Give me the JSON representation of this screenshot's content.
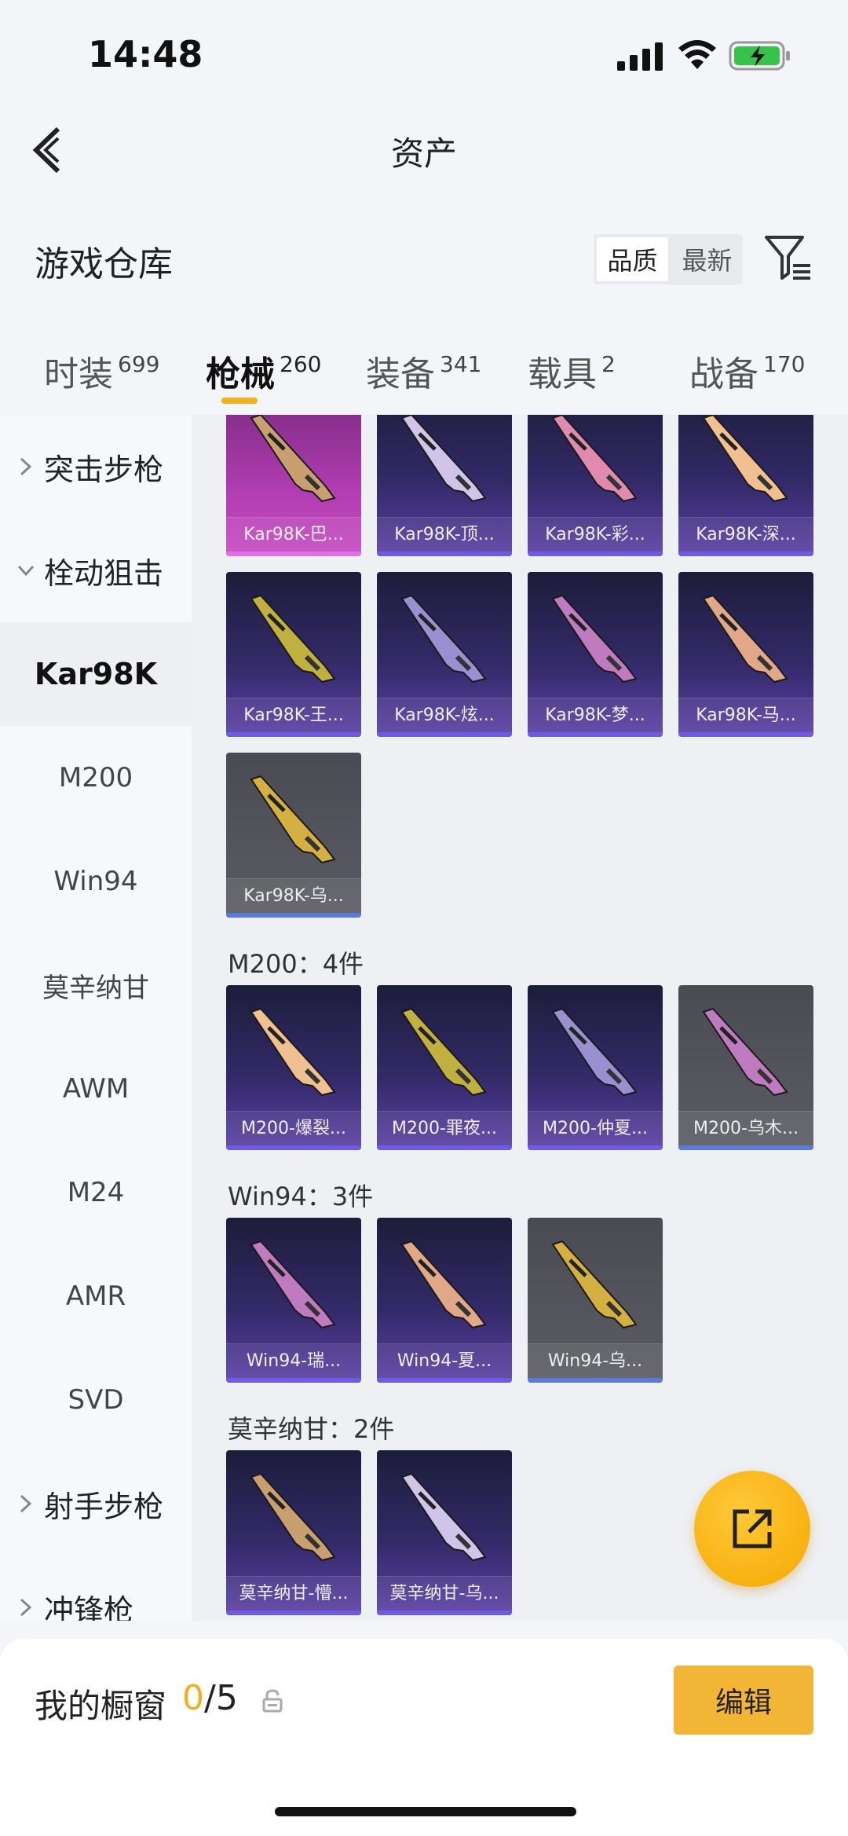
{
  "status_bar": {
    "time": "14:48",
    "icons": [
      "signal-icon",
      "wifi-icon",
      "battery-charging-icon"
    ]
  },
  "nav": {
    "title": "资产",
    "back_icon": "chevron-left-icon"
  },
  "warehouse": {
    "title": "游戏仓库",
    "sort_options": [
      "品质",
      "最新"
    ],
    "sort_selected": "品质",
    "filter_icon": "filter-icon"
  },
  "tabs": [
    {
      "label": "时装",
      "count": "699"
    },
    {
      "label": "枪械",
      "count": "260",
      "active": true
    },
    {
      "label": "装备",
      "count": "341"
    },
    {
      "label": "载具",
      "count": "2"
    },
    {
      "label": "战备",
      "count": "170"
    }
  ],
  "side_nav": [
    {
      "label": "突击步枪",
      "type": "group",
      "expanded": false
    },
    {
      "label": "栓动狙击",
      "type": "group",
      "expanded": true
    },
    {
      "label": "Kar98K",
      "type": "item",
      "selected": true
    },
    {
      "label": "M200",
      "type": "item"
    },
    {
      "label": "Win94",
      "type": "item"
    },
    {
      "label": "莫辛纳甘",
      "type": "item"
    },
    {
      "label": "AWM",
      "type": "item"
    },
    {
      "label": "M24",
      "type": "item"
    },
    {
      "label": "AMR",
      "type": "item"
    },
    {
      "label": "SVD",
      "type": "item"
    },
    {
      "label": "射手步枪",
      "type": "group",
      "expanded": false
    },
    {
      "label": "冲锋枪",
      "type": "group",
      "expanded": false
    }
  ],
  "groups": [
    {
      "heading": "",
      "items": [
        {
          "label": "Kar98K-巴...",
          "rarity": "pink"
        },
        {
          "label": "Kar98K-顶...",
          "rarity": "purple"
        },
        {
          "label": "Kar98K-彩...",
          "rarity": "purple"
        },
        {
          "label": "Kar98K-深...",
          "rarity": "purple"
        },
        {
          "label": "Kar98K-王...",
          "rarity": "purple"
        },
        {
          "label": "Kar98K-炫...",
          "rarity": "purple"
        },
        {
          "label": "Kar98K-梦...",
          "rarity": "purple"
        },
        {
          "label": "Kar98K-马...",
          "rarity": "purple"
        },
        {
          "label": "Kar98K-乌...",
          "rarity": "grey"
        }
      ]
    },
    {
      "heading": "M200：4件",
      "items": [
        {
          "label": "M200-爆裂...",
          "rarity": "purple"
        },
        {
          "label": "M200-罪夜...",
          "rarity": "purple"
        },
        {
          "label": "M200-仲夏...",
          "rarity": "purple"
        },
        {
          "label": "M200-乌木...",
          "rarity": "grey"
        }
      ]
    },
    {
      "heading": "Win94：3件",
      "items": [
        {
          "label": "Win94-瑞...",
          "rarity": "purple"
        },
        {
          "label": "Win94-夏...",
          "rarity": "purple"
        },
        {
          "label": "Win94-乌...",
          "rarity": "grey"
        }
      ]
    },
    {
      "heading": "莫辛纳甘：2件",
      "items": [
        {
          "label": "莫辛纳甘-懵...",
          "rarity": "purple"
        },
        {
          "label": "莫辛纳甘-乌...",
          "rarity": "purple"
        }
      ]
    }
  ],
  "fab": {
    "icon": "share-icon"
  },
  "showcase": {
    "title": "我的橱窗",
    "current": "0",
    "max": "/5",
    "lock_icon": "lock-icon",
    "edit_label": "编辑"
  },
  "colors": {
    "accent": "#f0b020",
    "button": "#f3b535",
    "purple_card": "#332a68",
    "grey_card": "#55565d",
    "pink_card": "#b13db0"
  }
}
